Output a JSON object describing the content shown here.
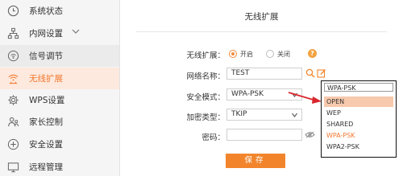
{
  "sidebar": {
    "items": [
      {
        "label": "系统状态",
        "icon": "clock-icon"
      },
      {
        "label": "内网设置",
        "icon": "network-icon"
      },
      {
        "label": "信号调节",
        "icon": "wifi-signal-icon"
      },
      {
        "label": "无线扩展",
        "icon": "wireless-extend-icon"
      },
      {
        "label": "WPS设置",
        "icon": "gear-icon"
      },
      {
        "label": "家长控制",
        "icon": "parent-icon"
      },
      {
        "label": "安全设置",
        "icon": "shield-icon"
      },
      {
        "label": "远程管理",
        "icon": "remote-icon"
      }
    ],
    "active_index": 3
  },
  "main": {
    "title": "无线扩展",
    "wireless_extend": {
      "label": "无线扩展：",
      "on_label": "开启",
      "off_label": "关闭",
      "selected": "开启",
      "help_glyph": "?"
    },
    "network_name": {
      "label": "网络名称：",
      "value": "TEST"
    },
    "security_mode": {
      "label": "安全模式：",
      "value": "WPA-PSK"
    },
    "encryption": {
      "label": "加密类型：",
      "value": "TKIP"
    },
    "password": {
      "label": "密码：",
      "value": ""
    },
    "save_label": "保存"
  },
  "dropdown": {
    "selected": "WPA-PSK",
    "options": [
      "OPEN",
      "WEP",
      "SHARED",
      "WPA-PSK",
      "WPA2-PSK"
    ],
    "hover_option": "OPEN"
  },
  "colors": {
    "accent": "#f2852c",
    "active_bg": "#fde9de",
    "arrow": "#d9262c"
  }
}
